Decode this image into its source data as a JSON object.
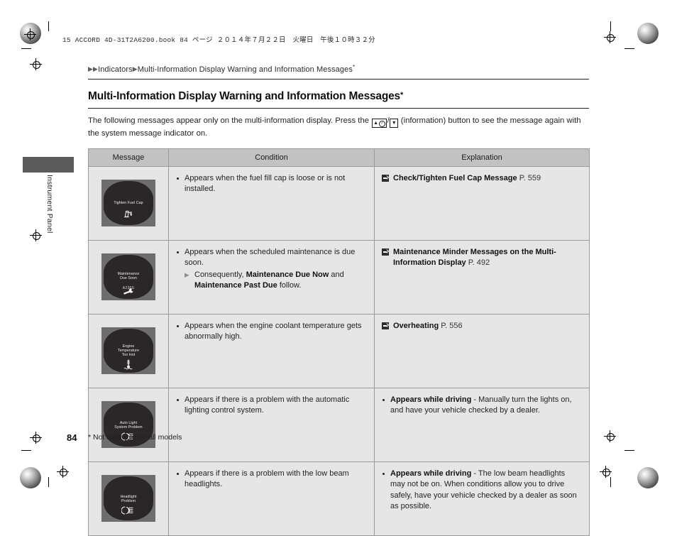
{
  "document": {
    "book_line": "15 ACCORD 4D-31T2A6200.book   84 ページ   ２０１４年７月２２日　火曜日　午後１０時３２分",
    "page_number": "84",
    "footnote": "* Not available on all models",
    "side_tab_label": "Instrument Panel"
  },
  "breadcrumb": {
    "marker": "▶",
    "level1": "Indicators",
    "level2": "Multi-Information Display Warning and Information Messages",
    "superscript": "*"
  },
  "title": {
    "text": "Multi-Information Display Warning and Information Messages",
    "superscript": "*"
  },
  "intro": {
    "part1": "The following messages appear only on the multi-information display. Press the ",
    "button_up_glyph": "▲",
    "button_info_glyph": "i",
    "separator": "/",
    "button_down_glyph": "▼",
    "part2": " (information) button to see the message again with the system message indicator on."
  },
  "table": {
    "headers": [
      "Message",
      "Condition",
      "Explanation"
    ],
    "rows": [
      {
        "display": {
          "line1": "Tighten Fuel Cap",
          "line2": "",
          "code": "",
          "glyph": "⛽",
          "icon_name": "fuel-pump-icon"
        },
        "condition": {
          "bullet": "Appears when the fuel fill cap is loose or is not installed.",
          "sub": ""
        },
        "explanation": {
          "type": "reference",
          "ref_title": "Check/Tighten Fuel Cap Message",
          "ref_page": "P. 559"
        }
      },
      {
        "display": {
          "line1": "Maintenance",
          "line2": "Due Soon",
          "code": "A230S",
          "glyph": "🔧",
          "icon_name": "wrench-icon"
        },
        "condition": {
          "bullet": "Appears when the scheduled maintenance is due soon.",
          "sub_prefix": "Consequently, ",
          "sub_bold1": "Maintenance Due Now",
          "sub_mid": " and ",
          "sub_bold2": "Maintenance Past Due",
          "sub_suffix": " follow."
        },
        "explanation": {
          "type": "reference",
          "ref_title": "Maintenance Minder Messages on the Multi-Information Display",
          "ref_page": "P. 492"
        }
      },
      {
        "display": {
          "line1": "Engine",
          "line2": "Temperature",
          "line3": "Too Hot",
          "code": "",
          "glyph": "🌡",
          "icon_name": "coolant-temperature-icon"
        },
        "condition": {
          "bullet": "Appears when the engine coolant temperature gets abnormally high.",
          "sub": ""
        },
        "explanation": {
          "type": "reference",
          "ref_title": "Overheating",
          "ref_page": "P. 556"
        }
      },
      {
        "display": {
          "line1": "Auto Light",
          "line2": "System Problem",
          "code": "",
          "glyph": "☀",
          "icon_name": "headlight-icon"
        },
        "condition": {
          "bullet": "Appears if there is a problem with the automatic lighting control system.",
          "sub": ""
        },
        "explanation": {
          "type": "bullet",
          "bold": "Appears while driving",
          "rest": " - Manually turn the lights on, and have your vehicle checked by a dealer."
        }
      },
      {
        "display": {
          "line1": "Headlight",
          "line2": "Problem",
          "code": "",
          "glyph": "☀",
          "icon_name": "headlight-icon"
        },
        "condition": {
          "bullet": "Appears if there is a problem with the low beam headlights.",
          "sub": ""
        },
        "explanation": {
          "type": "bullet",
          "bold": "Appears while driving",
          "rest": " - The low beam headlights may not be on. When conditions allow you to drive safely, have your vehicle checked by a dealer as soon as possible."
        }
      }
    ]
  },
  "colors": {
    "header_bg": "#c2c2c2",
    "cell_bg": "#e6e6e6",
    "border": "#9a9a9a",
    "display_bg": "#6e6e6e",
    "display_screen": "#2b2628",
    "tab": "#5b5b5b",
    "text": "#231f20"
  }
}
